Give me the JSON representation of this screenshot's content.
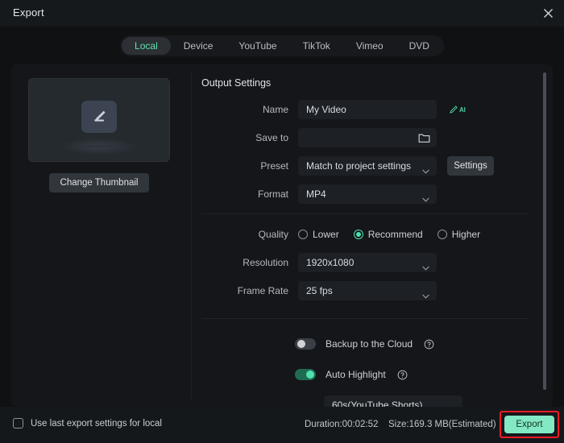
{
  "window": {
    "title": "Export",
    "close_icon": "close-icon"
  },
  "tabs": [
    {
      "label": "Local",
      "active": true
    },
    {
      "label": "Device",
      "active": false
    },
    {
      "label": "YouTube",
      "active": false
    },
    {
      "label": "TikTok",
      "active": false
    },
    {
      "label": "Vimeo",
      "active": false
    },
    {
      "label": "DVD",
      "active": false
    }
  ],
  "thumbnail": {
    "icon": "pencil-edit-icon",
    "change_button_label": "Change Thumbnail"
  },
  "output_settings": {
    "section_title": "Output Settings",
    "name": {
      "label": "Name",
      "value": "My Video",
      "placeholder": "",
      "ai_icon": "ai-pencil-icon"
    },
    "save_to": {
      "label": "Save to",
      "value": "",
      "placeholder": "",
      "browse_icon": "folder-icon"
    },
    "preset": {
      "label": "Preset",
      "value": "Match to project settings",
      "settings_button_label": "Settings"
    },
    "format": {
      "label": "Format",
      "value": "MP4"
    },
    "quality": {
      "label": "Quality",
      "options": [
        {
          "label": "Lower",
          "selected": false
        },
        {
          "label": "Recommend",
          "selected": true
        },
        {
          "label": "Higher",
          "selected": false
        }
      ]
    },
    "resolution": {
      "label": "Resolution",
      "value": "1920x1080"
    },
    "frame_rate": {
      "label": "Frame Rate",
      "value": "25 fps"
    }
  },
  "extras": {
    "backup_cloud": {
      "label": "Backup to the Cloud",
      "enabled": false,
      "help_icon": "help-circle-icon"
    },
    "auto_highlight": {
      "label": "Auto Highlight",
      "enabled": true,
      "help_icon": "help-circle-icon"
    },
    "highlight_duration": {
      "value": "60s(YouTube Shorts)"
    }
  },
  "footer": {
    "use_last_settings_label": "Use last export settings for local",
    "use_last_settings_checked": false,
    "duration": "Duration:00:02:52",
    "size": "Size:169.3 MB(Estimated)",
    "export_button_label": "Export"
  },
  "colors": {
    "accent_teal": "#4fe0ae",
    "export_button_bg": "#83e9c4",
    "highlight_red": "#ee1b24",
    "window_bg": "#0f1113",
    "panel_bg": "#141619",
    "field_bg": "#1d2024"
  }
}
